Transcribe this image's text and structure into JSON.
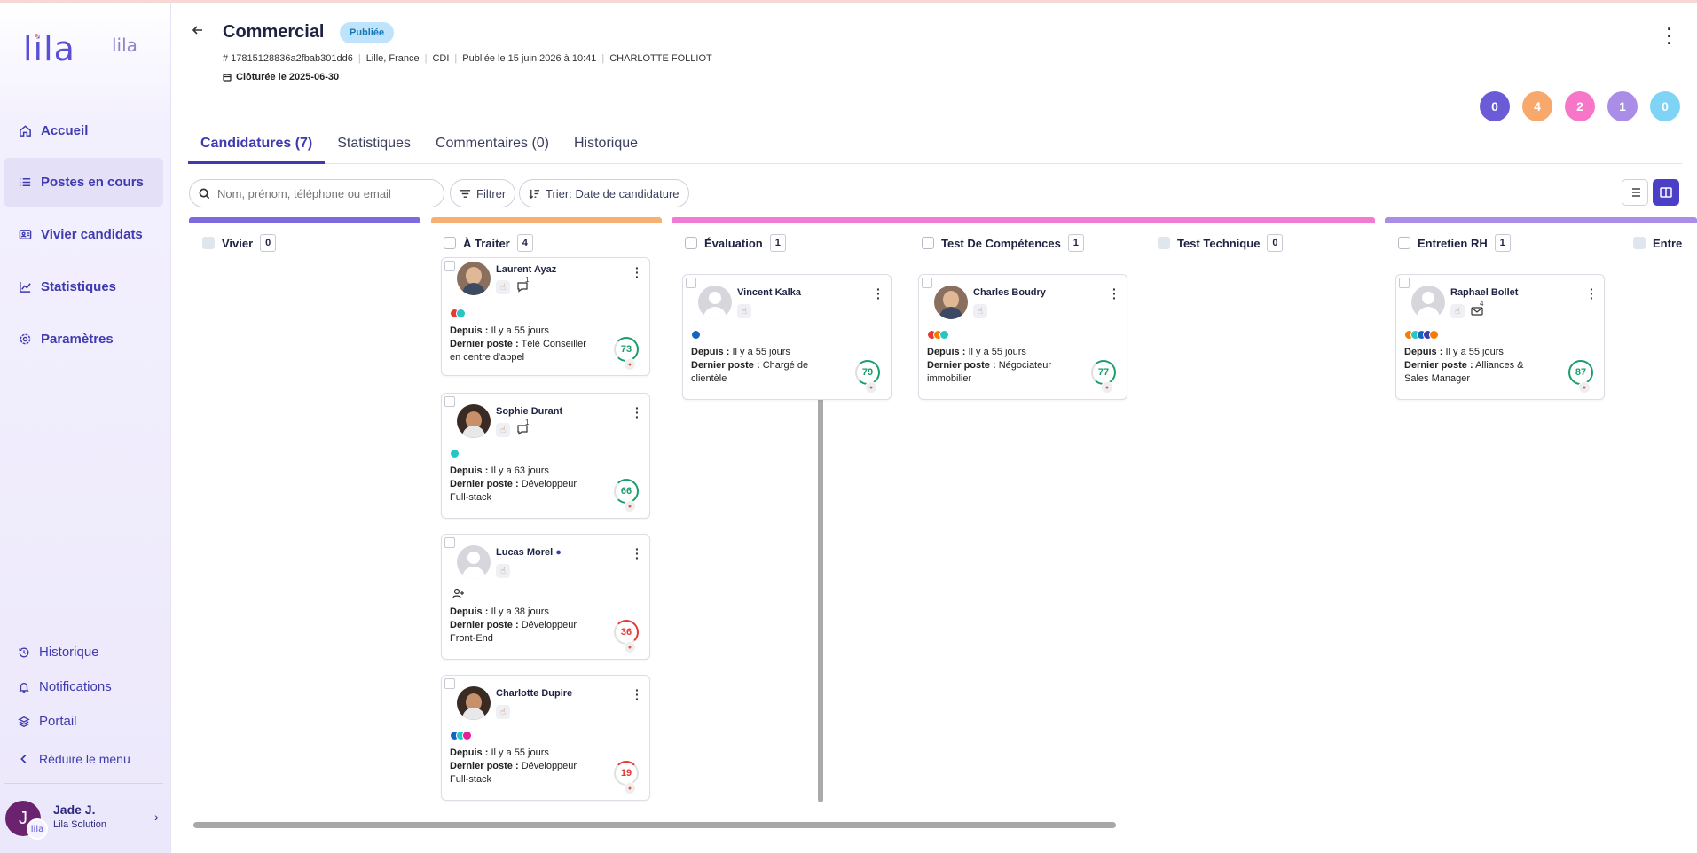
{
  "sidebar": {
    "logo": "lila",
    "logo_secondary": "lila",
    "nav": [
      {
        "label": "Accueil",
        "icon": "home-icon"
      },
      {
        "label": "Postes en cours",
        "icon": "list-icon"
      },
      {
        "label": "Vivier candidats",
        "icon": "id-card-icon"
      },
      {
        "label": "Statistiques",
        "icon": "chart-icon"
      },
      {
        "label": "Paramètres",
        "icon": "gear-icon"
      }
    ],
    "bottom": [
      {
        "label": "Historique",
        "icon": "history-icon"
      },
      {
        "label": "Notifications",
        "icon": "bell-icon"
      },
      {
        "label": "Portail",
        "icon": "layers-icon"
      },
      {
        "label": "Réduire le menu",
        "icon": "chevron-left-icon"
      }
    ],
    "user": {
      "initial": "J",
      "badge": "lila",
      "name": "Jade J.",
      "org": "Lila Solution"
    }
  },
  "header": {
    "title": "Commercial",
    "status": "Publiée",
    "meta": [
      "# 17815128836a2fbab301dd6",
      "Lille, France",
      "CDI",
      "Publiée le 15 juin 2026 à 10:41",
      "CHARLOTTE FOLLIOT"
    ],
    "closed": "Clôturée le 2025-06-30"
  },
  "counters": [
    {
      "value": "0",
      "color": "#6b5bd6"
    },
    {
      "value": "4",
      "color": "#f7a86a"
    },
    {
      "value": "2",
      "color": "#f776c8"
    },
    {
      "value": "1",
      "color": "#a98de6"
    },
    {
      "value": "0",
      "color": "#7fd3f5"
    }
  ],
  "tabs": [
    "Candidatures (7)",
    "Statistiques",
    "Commentaires (0)",
    "Historique"
  ],
  "toolbar": {
    "search_placeholder": "Nom, prénom, téléphone ou email",
    "filter": "Filtrer",
    "sort": "Trier: Date de candidature"
  },
  "columns": [
    {
      "title": "Vivier",
      "count": "0",
      "color": "#7b6ae0"
    },
    {
      "title": "À Traiter",
      "count": "4",
      "color": "#f7b072"
    },
    {
      "title": "Évaluation",
      "count": "1",
      "color": "#f27ad0"
    },
    {
      "title": "Test De Compétences",
      "count": "1",
      "color": "#f27ad0"
    },
    {
      "title": "Test Technique",
      "count": "0",
      "color": "#f27ad0"
    },
    {
      "title": "Entretien RH",
      "count": "1",
      "color": "#a98de6"
    },
    {
      "title": "Entre",
      "count": "",
      "color": "#a98de6"
    }
  ],
  "labels": {
    "since": "Depuis :",
    "last_job": "Dernier poste :"
  },
  "cards": [
    {
      "name": "Laurent Ayaz",
      "msgs": "1",
      "since": "Il y a 55 jours",
      "last_job": "Télé Conseiller en centre d'appel",
      "score": "73",
      "score_color": "#1a9e6b",
      "dots": [
        "#e53935",
        "#26c6c6"
      ]
    },
    {
      "name": "Sophie Durant",
      "msgs": "1",
      "since": "Il y a 63 jours",
      "last_job": "Développeur Full-stack",
      "score": "66",
      "score_color": "#1a9e6b",
      "dots": [
        "#26c6c6"
      ]
    },
    {
      "name": "Lucas Morel",
      "since": "Il y a 38 jours",
      "last_job": "Développeur Front-End",
      "score": "36",
      "score_color": "#e53935",
      "dots": []
    },
    {
      "name": "Charlotte Dupire",
      "since": "Il y a 55 jours",
      "last_job": "Développeur Full-stack",
      "score": "19",
      "score_color": "#e53935",
      "dots": [
        "#1565c0",
        "#26c6c6",
        "#e91e9c"
      ]
    },
    {
      "name": "Vincent Kalka",
      "since": "Il y a 55 jours",
      "last_job": "Chargé de clientèle",
      "score": "79",
      "score_color": "#1a9e6b",
      "dots": [
        "#1565c0"
      ]
    },
    {
      "name": "Charles Boudry",
      "since": "Il y a 55 jours",
      "last_job": "Négociateur immobilier",
      "score": "77",
      "score_color": "#1a9e6b",
      "dots": [
        "#e53935",
        "#f57c00",
        "#26c6c6"
      ]
    },
    {
      "name": "Raphael Bollet",
      "msgs": "4",
      "since": "Il y a 55 jours",
      "last_job": "Alliances & Sales Manager",
      "score": "87",
      "score_color": "#1a9e6b",
      "dots": [
        "#f57c00",
        "#26c6c6",
        "#1565c0",
        "#3f3ab0",
        "#f57c00"
      ]
    }
  ]
}
